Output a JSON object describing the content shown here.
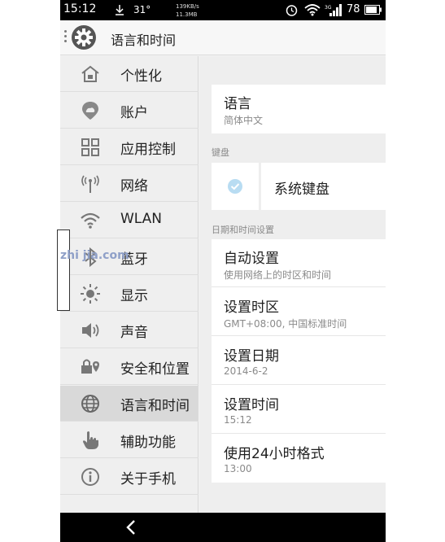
{
  "status_bar": {
    "time": "15:12",
    "temperature": "31°",
    "net_speed": "139KB/s",
    "data_used": "11.3MB",
    "battery": "78"
  },
  "header": {
    "title": "语言和时间"
  },
  "sidebar": {
    "items": [
      {
        "label": "个性化",
        "icon": "home-icon"
      },
      {
        "label": "账户",
        "icon": "account-icon"
      },
      {
        "label": "应用控制",
        "icon": "grid-icon"
      },
      {
        "label": "网络",
        "icon": "antenna-icon"
      },
      {
        "label": "WLAN",
        "icon": "wifi-icon"
      },
      {
        "label": "蓝牙",
        "icon": "bluetooth-icon"
      },
      {
        "label": "显示",
        "icon": "brightness-icon"
      },
      {
        "label": "声音",
        "icon": "speaker-icon"
      },
      {
        "label": "安全和位置",
        "icon": "lock-icon"
      },
      {
        "label": "语言和时间",
        "icon": "globe-icon",
        "active": true
      },
      {
        "label": "辅助功能",
        "icon": "hand-icon"
      },
      {
        "label": "关于手机",
        "icon": "info-icon"
      }
    ]
  },
  "content": {
    "language": {
      "title": "语言",
      "value": "简体中文"
    },
    "keyboard_section": "键盘",
    "keyboard": {
      "label": "系统键盘",
      "checked": true
    },
    "datetime_section": "日期和时间设置",
    "auto_setting": {
      "title": "自动设置",
      "subtitle": "使用网络上的时区和时间"
    },
    "timezone": {
      "title": "设置时区",
      "value": "GMT+08:00, 中国标准时间"
    },
    "date": {
      "title": "设置日期",
      "value": "2014-6-2"
    },
    "time": {
      "title": "设置时间",
      "value": "15:12"
    },
    "format24": {
      "title": "使用24小时格式",
      "value": "13:00"
    }
  },
  "watermark": {
    "text": "zhi jia.com"
  },
  "colors": {
    "accent_check": "#4aa3df",
    "status_bar": "#000000"
  }
}
